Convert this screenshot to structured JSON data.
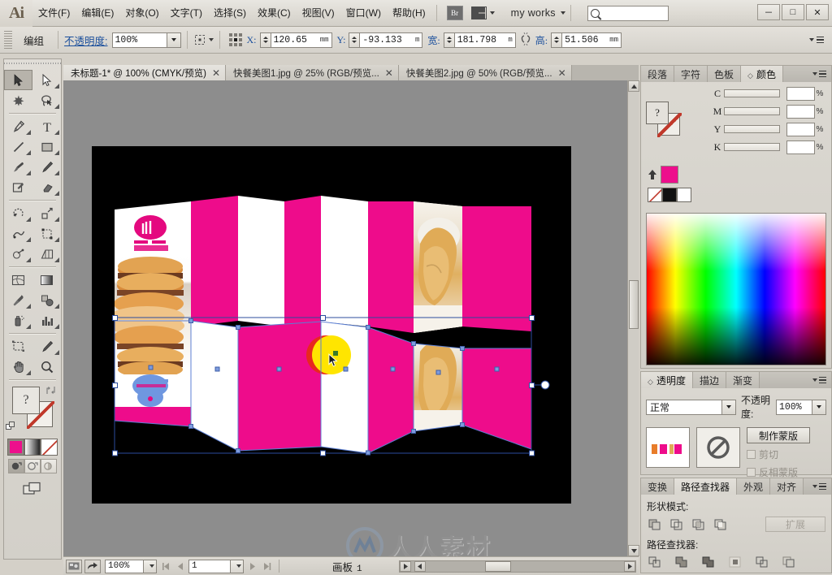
{
  "app": {
    "logo": "Ai"
  },
  "menubar": {
    "items": [
      "文件(F)",
      "编辑(E)",
      "对象(O)",
      "文字(T)",
      "选择(S)",
      "效果(C)",
      "视图(V)",
      "窗口(W)",
      "帮助(H)"
    ],
    "bridge_label": "Br",
    "workspace": "my works",
    "search_placeholder": "",
    "window_buttons": [
      "－",
      "□",
      "✕"
    ]
  },
  "controlbar": {
    "selection_label": "编组",
    "opacity_label": "不透明度:",
    "opacity_value": "100%",
    "x_label": "X:",
    "x_value": "120.65",
    "x_unit": "mm",
    "y_label": "Y:",
    "y_value": "-93.133",
    "y_unit": "m",
    "w_label": "宽:",
    "w_value": "181.798",
    "w_unit": "m",
    "h_label": "高:",
    "h_value": "51.506",
    "h_unit": "mm"
  },
  "tabs": [
    {
      "label": "未标题-1* @ 100% (CMYK/预览)",
      "close": "✕",
      "active": true
    },
    {
      "label": "快餐美图1.jpg @ 25% (RGB/预览...",
      "close": "✕",
      "active": false
    },
    {
      "label": "快餐美图2.jpg @ 50% (RGB/预览...",
      "close": "✕",
      "active": false
    }
  ],
  "toolbar": {
    "tools": [
      "selection-tool",
      "direct-selection-tool",
      "magic-wand-tool",
      "lasso-tool",
      "pen-tool",
      "type-tool",
      "line-segment-tool",
      "rectangle-tool",
      "paintbrush-tool",
      "pencil-tool",
      "blob-brush-tool",
      "eraser-tool",
      "rotate-tool",
      "scale-tool",
      "width-tool",
      "free-transform-tool",
      "shape-builder-tool",
      "perspective-grid-tool",
      "mesh-tool",
      "gradient-tool",
      "eyedropper-tool",
      "blend-tool",
      "symbol-sprayer-tool",
      "column-graph-tool",
      "artboard-tool",
      "slice-tool",
      "hand-tool",
      "zoom-tool"
    ],
    "fill_color": "#ED0F8C",
    "stroke_color": "none",
    "fill_question": "?",
    "color_modes": [
      "color-swatch",
      "gradient-swatch",
      "none-swatch"
    ],
    "draw_modes": [
      "draw-normal",
      "draw-behind",
      "draw-inside"
    ],
    "screen_mode": "screen-mode"
  },
  "canvas": {
    "artboard_background": "#000000",
    "pink": "#EE0C8B",
    "white": "#FFFFFF",
    "yellow_dot": "#FFE500",
    "red_dot": "#E8281E",
    "selection_color": "#5B7FD4",
    "top_panels": [
      {
        "kind": "image-cookie",
        "fill": "#ffffff"
      },
      {
        "kind": "solid",
        "fill": "#EE0C8B"
      },
      {
        "kind": "solid",
        "fill": "#FFFFFF"
      },
      {
        "kind": "solid",
        "fill": "#EE0C8B"
      },
      {
        "kind": "solid",
        "fill": "#FFFFFF"
      },
      {
        "kind": "solid",
        "fill": "#EE0C8B"
      },
      {
        "kind": "image-bread",
        "fill": "#ffffff"
      },
      {
        "kind": "solid",
        "fill": "#EE0C8B"
      }
    ],
    "bottom_panels": [
      {
        "kind": "image-cookie",
        "fill": "#ffffff"
      },
      {
        "kind": "solid",
        "fill": "#FFFFFF"
      },
      {
        "kind": "solid",
        "fill": "#EE0C8B"
      },
      {
        "kind": "solid",
        "fill": "#FFFFFF"
      },
      {
        "kind": "solid",
        "fill": "#EE0C8B"
      },
      {
        "kind": "image-bread",
        "fill": "#ffffff"
      },
      {
        "kind": "solid",
        "fill": "#EE0C8B"
      }
    ]
  },
  "statusbar": {
    "zoom_value": "100%",
    "artboard_number": "1",
    "artboard_label": "画板",
    "artboard_index": "1",
    "nav_first": "◀|",
    "nav_prev": "◀",
    "nav_next": "▶",
    "nav_last": "|▶"
  },
  "watermark": {
    "text": "人人素材"
  },
  "panels": {
    "color": {
      "tabs": [
        "段落",
        "字符",
        "色板",
        "颜色"
      ],
      "active_tab": "颜色",
      "channels": [
        {
          "name": "C",
          "value": ""
        },
        {
          "name": "M",
          "value": ""
        },
        {
          "name": "Y",
          "value": ""
        },
        {
          "name": "K",
          "value": ""
        }
      ],
      "percent_symbol": "%",
      "fill_question": "?",
      "current_color": "#ED0F8C"
    },
    "transparency": {
      "tabs": [
        "透明度",
        "描边",
        "渐变"
      ],
      "active_tab": "透明度",
      "blend_mode": "正常",
      "opacity_label": "不透明度:",
      "opacity_value": "100%",
      "make_mask_button": "制作蒙版",
      "clip_label": "剪切",
      "invert_label": "反相蒙版"
    },
    "pathfinder": {
      "tabs": [
        "变换",
        "路径查找器",
        "外观",
        "对齐"
      ],
      "active_tab": "路径查找器",
      "shape_modes_label": "形状模式:",
      "pathfinders_label": "路径查找器:",
      "expand_button": "扩展",
      "shape_mode_icons": [
        "unite-icon",
        "minus-front-icon",
        "intersect-icon",
        "exclude-icon"
      ],
      "pathfinder_icons": [
        "divide-icon",
        "trim-icon",
        "merge-icon",
        "crop-icon",
        "outline-icon",
        "minus-back-icon"
      ]
    }
  }
}
